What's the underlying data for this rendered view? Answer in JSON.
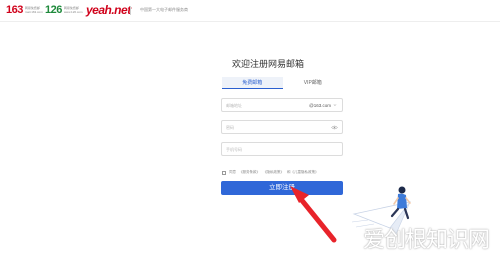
{
  "header": {
    "logos": [
      {
        "name": "163",
        "sub_line1": "网易免费邮",
        "sub_line2": "mail.163.com"
      },
      {
        "name": "126",
        "sub_line1": "网易免费邮",
        "sub_line2": "www.126.com"
      },
      {
        "name": "yeah.net"
      }
    ],
    "slogan": "中国第一大电子邮件服务商"
  },
  "title": "欢迎注册网易邮箱",
  "tabs": [
    {
      "label": "免费邮箱",
      "active": true
    },
    {
      "label": "VIP邮箱",
      "active": false
    }
  ],
  "form": {
    "email_placeholder": "邮箱地址",
    "email_domain": "@163.com",
    "password_placeholder": "密码",
    "phone_placeholder": "手机号码",
    "agree_prefix": "同意",
    "agree_items": [
      "《服务条款》",
      "《隐私政策》",
      "和《儿童隐私政策》"
    ],
    "submit_label": "立即注册"
  },
  "watermark": "爱创根知识网",
  "colors": {
    "accent": "#2f67d8",
    "annotation_arrow": "#e8232a",
    "brand_163": "#d0021b",
    "brand_126": "#1f8a3c"
  }
}
